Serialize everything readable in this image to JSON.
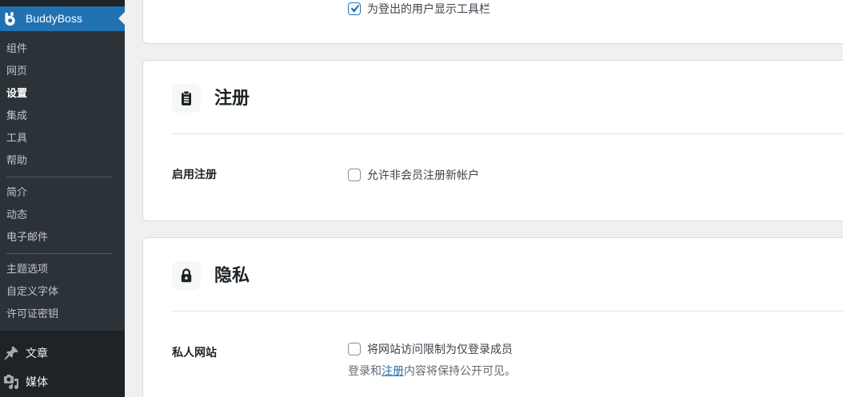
{
  "sidebar": {
    "brand": {
      "label": "BuddyBoss",
      "icon": "buddyboss-logo-icon"
    },
    "submenu_groups": [
      {
        "items": [
          {
            "label": "组件"
          },
          {
            "label": "网页"
          },
          {
            "label": "设置",
            "current": true
          },
          {
            "label": "集成"
          },
          {
            "label": "工具"
          },
          {
            "label": "帮助"
          }
        ]
      },
      {
        "items": [
          {
            "label": "简介"
          },
          {
            "label": "动态"
          },
          {
            "label": "电子邮件"
          }
        ]
      },
      {
        "items": [
          {
            "label": "主题选项"
          },
          {
            "label": "自定义字体"
          },
          {
            "label": "许可证密钥"
          }
        ]
      }
    ],
    "menu_items": [
      {
        "label": "文章",
        "icon": "pin-icon"
      },
      {
        "label": "媒体",
        "icon": "media-icon"
      }
    ]
  },
  "settings": {
    "toolbar_section": {
      "option_label": "为登出的用户显示工具栏",
      "checked": true
    },
    "registration_section": {
      "title": "注册",
      "icon": "clipboard-icon",
      "field_label": "启用注册",
      "option_label": "允许非会员注册新帐户",
      "checked": false
    },
    "privacy_section": {
      "title": "隐私",
      "icon": "lock-icon",
      "field_label": "私人网站",
      "option_label": "将网站访问限制为仅登录成员",
      "checked": false,
      "description_before": "登录和",
      "description_link": "注册",
      "description_after": "内容将保持公开可见。"
    }
  },
  "colors": {
    "accent": "#2271b1",
    "sidebar_bg": "#1d2327",
    "submenu_bg": "#2c3338",
    "page_bg": "#f0f0f1"
  }
}
